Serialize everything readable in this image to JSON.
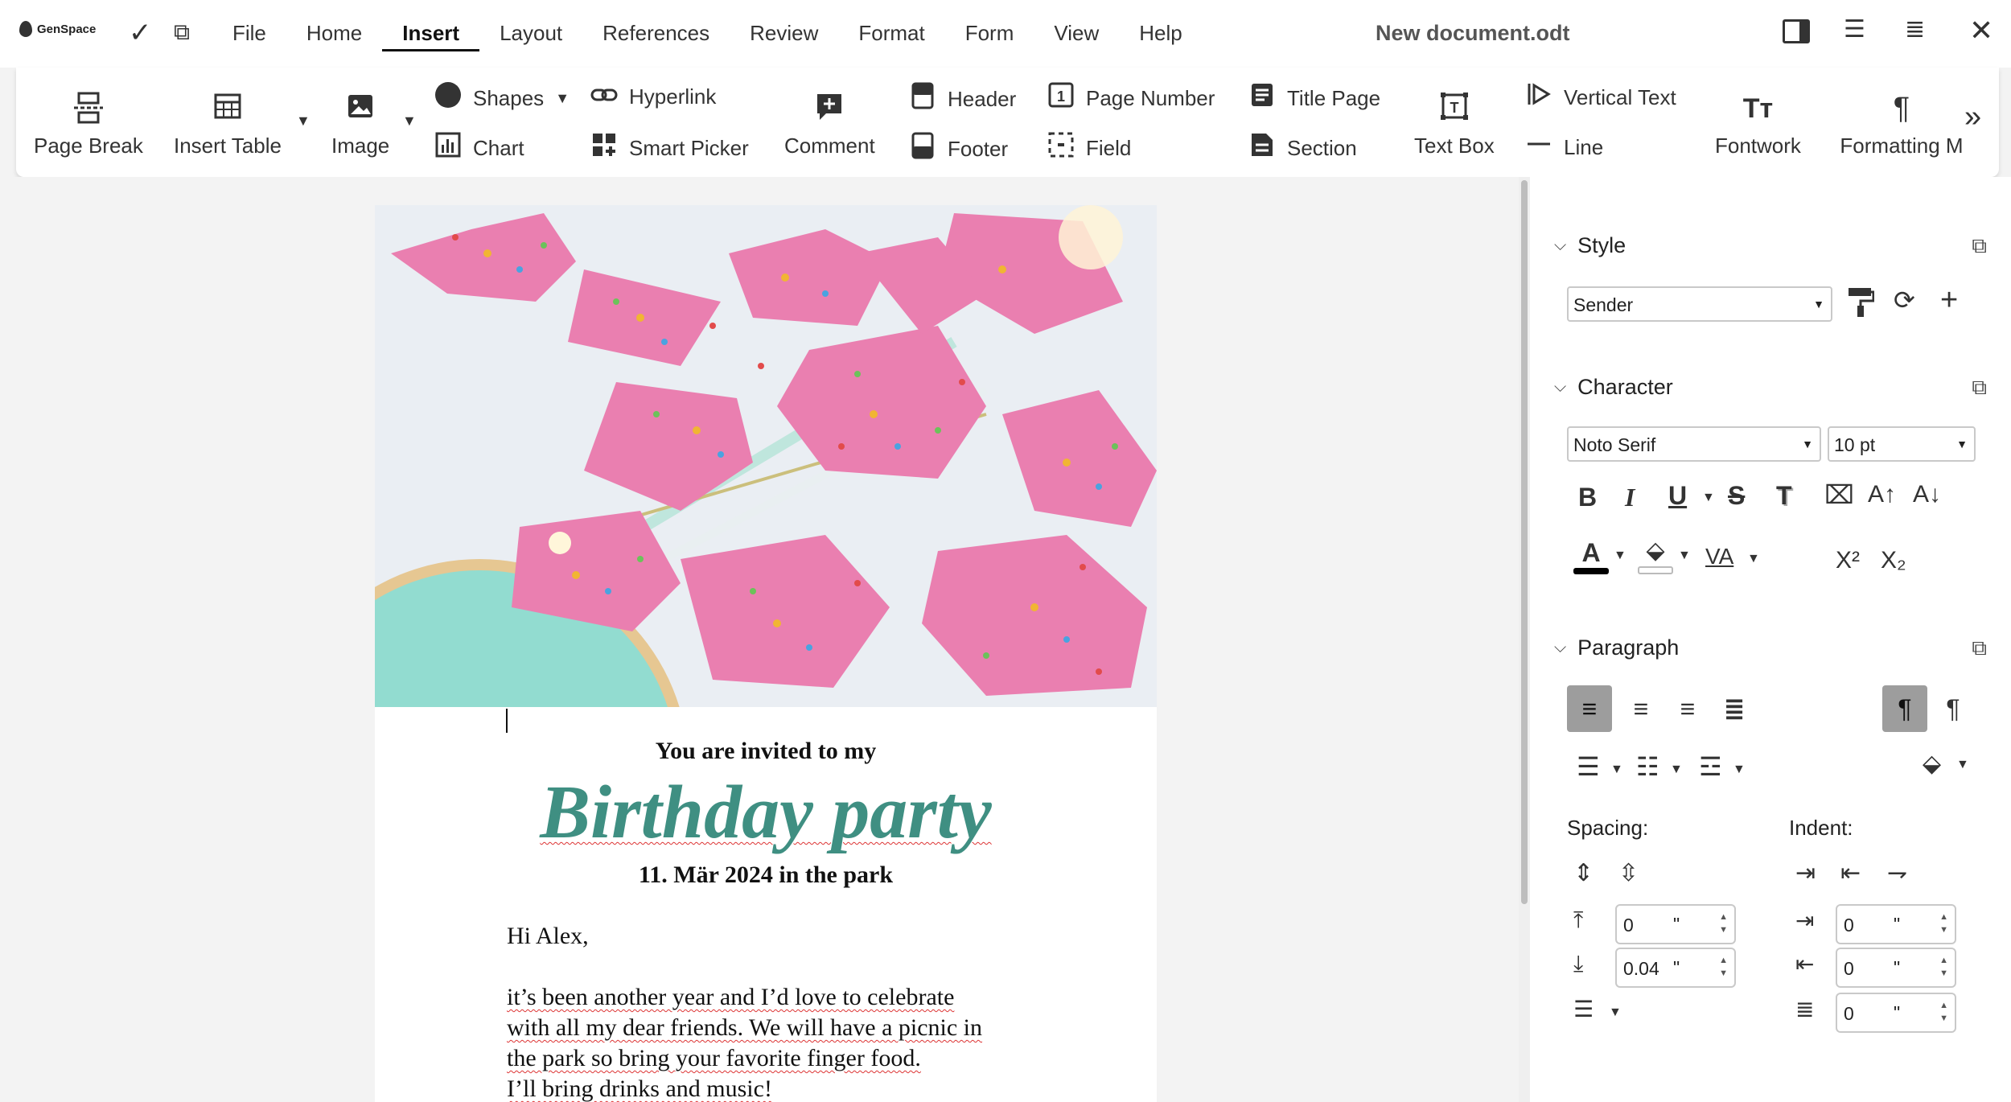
{
  "app": {
    "logo_text": "GenSpace",
    "document_title": "New document.odt"
  },
  "menu": {
    "items": [
      "File",
      "Home",
      "Insert",
      "Layout",
      "References",
      "Review",
      "Format",
      "Form",
      "View",
      "Help"
    ],
    "active": "Insert"
  },
  "ribbon": {
    "page_break": "Page Break",
    "insert_table": "Insert Table",
    "image": "Image",
    "shapes": "Shapes",
    "chart": "Chart",
    "hyperlink": "Hyperlink",
    "smart_picker": "Smart Picker",
    "comment": "Comment",
    "header": "Header",
    "footer": "Footer",
    "page_number": "Page Number",
    "field": "Field",
    "title_page": "Title Page",
    "section": "Section",
    "text_box": "Text Box",
    "vertical_text": "Vertical Text",
    "line": "Line",
    "fontwork": "Fontwork",
    "formatting": "Formatting M"
  },
  "document": {
    "invite_line": "You are invited to my",
    "headline": "Birthday party",
    "date_line": "11. Mär 2024 in the park",
    "greeting": "Hi Alex,",
    "body_lines": [
      "it’s been another year and I’d love to celebrate",
      "with all my dear friends. We will have a picnic in",
      "the park so bring your favorite finger food.",
      "I’ll bring drinks and music!"
    ],
    "headline_color": "#3f8f82"
  },
  "sidebar": {
    "style": {
      "title": "Style",
      "value": "Sender"
    },
    "character": {
      "title": "Character",
      "font": "Noto Serif",
      "size": "10 pt"
    },
    "paragraph": {
      "title": "Paragraph",
      "spacing_label": "Spacing:",
      "indent_label": "Indent:",
      "spacing_above": "0",
      "spacing_below": "0.04",
      "indent_before": "0",
      "indent_after": "0",
      "indent_first": "0",
      "unit": "\""
    }
  }
}
